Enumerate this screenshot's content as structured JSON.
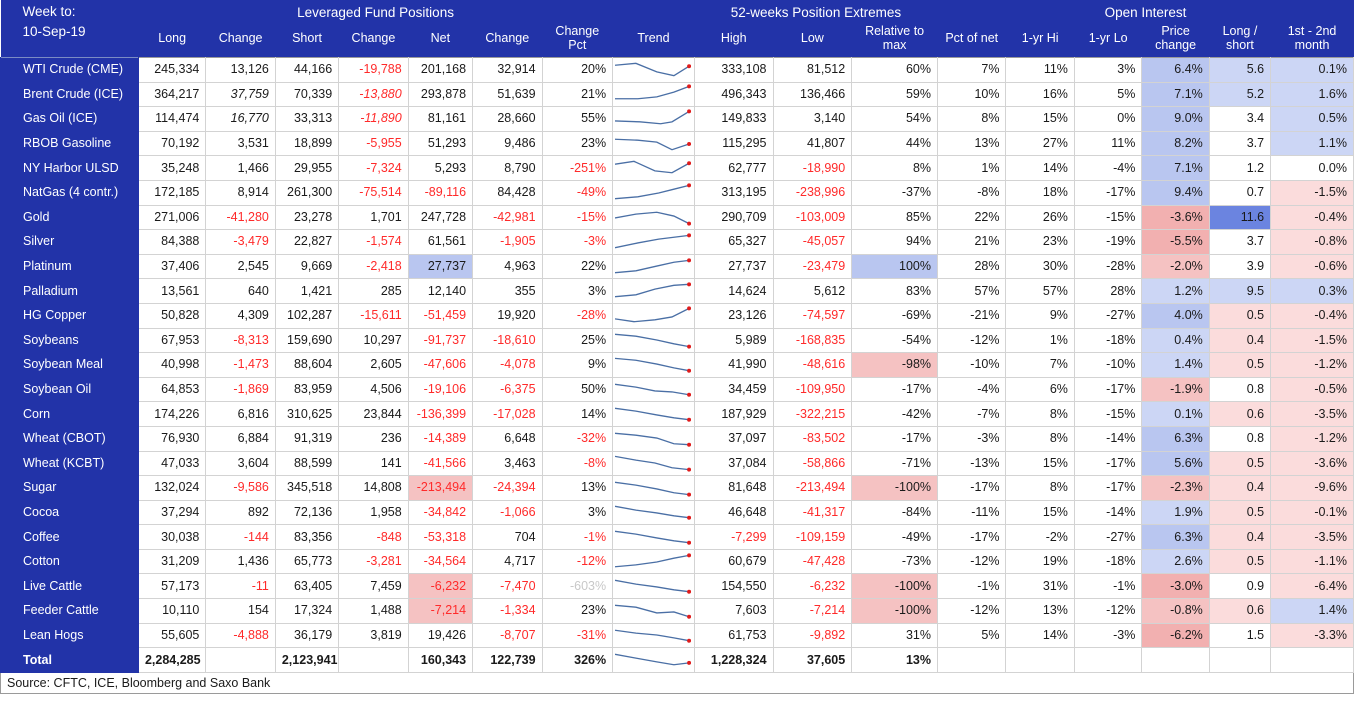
{
  "header": {
    "week_to_label": "Week to:",
    "week_to_date": "10-Sep-19",
    "groups": {
      "leveraged": "Leveraged Fund Positions",
      "trend": "Trend",
      "extremes": "52-weeks Position Extremes",
      "open_interest": "Open Interest"
    },
    "columns": {
      "long": "Long",
      "change1": "Change",
      "short": "Short",
      "change2": "Change",
      "net": "Net",
      "change3": "Change",
      "change_pct": "Change Pct",
      "trend": "Trend",
      "high": "High",
      "low": "Low",
      "rel_to_max": "Relative to max",
      "pct_of_net": "Pct of net",
      "yr_hi": "1-yr Hi",
      "yr_lo": "1-yr Lo",
      "price_change": "Price change",
      "long_short": "Long / short",
      "first_second": "1st - 2nd month"
    }
  },
  "colors": {
    "header_blue": "#2233a8",
    "negative_red": "#ff2a2a",
    "heat_blue_light": "#ccd6f5",
    "heat_blue_strong": "#6b84e0",
    "heat_red_light": "#fbdcdc",
    "heat_red_strong": "#f2b0b0"
  },
  "rows": [
    {
      "name": "WTI Crude (CME)",
      "long": "245,334",
      "change1": "13,126",
      "short": "44,166",
      "change2": "-19,788",
      "net": "201,168",
      "change3": "32,914",
      "change_pct": "20%",
      "high": "333,108",
      "low": "81,512",
      "rel": "60%",
      "pct_net": "7%",
      "yr_hi": "11%",
      "yr_lo": "3%",
      "price": "6.4%",
      "ls": "5.6",
      "m12": "0.1%"
    },
    {
      "name": "Brent Crude (ICE)",
      "long": "364,217",
      "change1": "37,759",
      "short": "70,339",
      "change2": "-13,880",
      "net": "293,878",
      "change3": "51,639",
      "change_pct": "21%",
      "high": "496,343",
      "low": "136,466",
      "rel": "59%",
      "pct_net": "10%",
      "yr_hi": "16%",
      "yr_lo": "5%",
      "price": "7.1%",
      "ls": "5.2",
      "m12": "1.6%"
    },
    {
      "name": "Gas Oil (ICE)",
      "long": "114,474",
      "change1": "16,770",
      "short": "33,313",
      "change2": "-11,890",
      "net": "81,161",
      "change3": "28,660",
      "change_pct": "55%",
      "high": "149,833",
      "low": "3,140",
      "rel": "54%",
      "pct_net": "8%",
      "yr_hi": "15%",
      "yr_lo": "0%",
      "price": "9.0%",
      "ls": "3.4",
      "m12": "0.5%"
    },
    {
      "name": "RBOB Gasoline",
      "long": "70,192",
      "change1": "3,531",
      "short": "18,899",
      "change2": "-5,955",
      "net": "51,293",
      "change3": "9,486",
      "change_pct": "23%",
      "high": "115,295",
      "low": "41,807",
      "rel": "44%",
      "pct_net": "13%",
      "yr_hi": "27%",
      "yr_lo": "11%",
      "price": "8.2%",
      "ls": "3.7",
      "m12": "1.1%"
    },
    {
      "name": "NY Harbor ULSD",
      "long": "35,248",
      "change1": "1,466",
      "short": "29,955",
      "change2": "-7,324",
      "net": "5,293",
      "change3": "8,790",
      "change_pct": "-251%",
      "high": "62,777",
      "low": "-18,990",
      "rel": "8%",
      "pct_net": "1%",
      "yr_hi": "14%",
      "yr_lo": "-4%",
      "price": "7.1%",
      "ls": "1.2",
      "m12": "0.0%"
    },
    {
      "name": "NatGas (4 contr.)",
      "long": "172,185",
      "change1": "8,914",
      "short": "261,300",
      "change2": "-75,514",
      "net": "-89,116",
      "change3": "84,428",
      "change_pct": "-49%",
      "high": "313,195",
      "low": "-238,996",
      "rel": "-37%",
      "pct_net": "-8%",
      "yr_hi": "18%",
      "yr_lo": "-17%",
      "price": "9.4%",
      "ls": "0.7",
      "m12": "-1.5%"
    },
    {
      "name": "Gold",
      "long": "271,006",
      "change1": "-41,280",
      "short": "23,278",
      "change2": "1,701",
      "net": "247,728",
      "change3": "-42,981",
      "change_pct": "-15%",
      "high": "290,709",
      "low": "-103,009",
      "rel": "85%",
      "pct_net": "22%",
      "yr_hi": "26%",
      "yr_lo": "-15%",
      "price": "-3.6%",
      "ls": "11.6",
      "m12": "-0.4%"
    },
    {
      "name": "Silver",
      "long": "84,388",
      "change1": "-3,479",
      "short": "22,827",
      "change2": "-1,574",
      "net": "61,561",
      "change3": "-1,905",
      "change_pct": "-3%",
      "high": "65,327",
      "low": "-45,057",
      "rel": "94%",
      "pct_net": "21%",
      "yr_hi": "23%",
      "yr_lo": "-19%",
      "price": "-5.5%",
      "ls": "3.7",
      "m12": "-0.8%"
    },
    {
      "name": "Platinum",
      "long": "37,406",
      "change1": "2,545",
      "short": "9,669",
      "change2": "-2,418",
      "net": "27,737",
      "change3": "4,963",
      "change_pct": "22%",
      "high": "27,737",
      "low": "-23,479",
      "rel": "100%",
      "pct_net": "28%",
      "yr_hi": "30%",
      "yr_lo": "-28%",
      "price": "-2.0%",
      "ls": "3.9",
      "m12": "-0.6%"
    },
    {
      "name": "Palladium",
      "long": "13,561",
      "change1": "640",
      "short": "1,421",
      "change2": "285",
      "net": "12,140",
      "change3": "355",
      "change_pct": "3%",
      "high": "14,624",
      "low": "5,612",
      "rel": "83%",
      "pct_net": "57%",
      "yr_hi": "57%",
      "yr_lo": "28%",
      "price": "1.2%",
      "ls": "9.5",
      "m12": "0.3%"
    },
    {
      "name": "HG Copper",
      "long": "50,828",
      "change1": "4,309",
      "short": "102,287",
      "change2": "-15,611",
      "net": "-51,459",
      "change3": "19,920",
      "change_pct": "-28%",
      "high": "23,126",
      "low": "-74,597",
      "rel": "-69%",
      "pct_net": "-21%",
      "yr_hi": "9%",
      "yr_lo": "-27%",
      "price": "4.0%",
      "ls": "0.5",
      "m12": "-0.4%"
    },
    {
      "name": "Soybeans",
      "long": "67,953",
      "change1": "-8,313",
      "short": "159,690",
      "change2": "10,297",
      "net": "-91,737",
      "change3": "-18,610",
      "change_pct": "25%",
      "high": "5,989",
      "low": "-168,835",
      "rel": "-54%",
      "pct_net": "-12%",
      "yr_hi": "1%",
      "yr_lo": "-18%",
      "price": "0.4%",
      "ls": "0.4",
      "m12": "-1.5%"
    },
    {
      "name": "Soybean Meal",
      "long": "40,998",
      "change1": "-1,473",
      "short": "88,604",
      "change2": "2,605",
      "net": "-47,606",
      "change3": "-4,078",
      "change_pct": "9%",
      "high": "41,990",
      "low": "-48,616",
      "rel": "-98%",
      "pct_net": "-10%",
      "yr_hi": "7%",
      "yr_lo": "-10%",
      "price": "1.4%",
      "ls": "0.5",
      "m12": "-1.2%"
    },
    {
      "name": "Soybean Oil",
      "long": "64,853",
      "change1": "-1,869",
      "short": "83,959",
      "change2": "4,506",
      "net": "-19,106",
      "change3": "-6,375",
      "change_pct": "50%",
      "high": "34,459",
      "low": "-109,950",
      "rel": "-17%",
      "pct_net": "-4%",
      "yr_hi": "6%",
      "yr_lo": "-17%",
      "price": "-1.9%",
      "ls": "0.8",
      "m12": "-0.5%"
    },
    {
      "name": "Corn",
      "long": "174,226",
      "change1": "6,816",
      "short": "310,625",
      "change2": "23,844",
      "net": "-136,399",
      "change3": "-17,028",
      "change_pct": "14%",
      "high": "187,929",
      "low": "-322,215",
      "rel": "-42%",
      "pct_net": "-7%",
      "yr_hi": "8%",
      "yr_lo": "-15%",
      "price": "0.1%",
      "ls": "0.6",
      "m12": "-3.5%"
    },
    {
      "name": "Wheat (CBOT)",
      "long": "76,930",
      "change1": "6,884",
      "short": "91,319",
      "change2": "236",
      "net": "-14,389",
      "change3": "6,648",
      "change_pct": "-32%",
      "high": "37,097",
      "low": "-83,502",
      "rel": "-17%",
      "pct_net": "-3%",
      "yr_hi": "8%",
      "yr_lo": "-14%",
      "price": "6.3%",
      "ls": "0.8",
      "m12": "-1.2%"
    },
    {
      "name": "Wheat (KCBT)",
      "long": "47,033",
      "change1": "3,604",
      "short": "88,599",
      "change2": "141",
      "net": "-41,566",
      "change3": "3,463",
      "change_pct": "-8%",
      "high": "37,084",
      "low": "-58,866",
      "rel": "-71%",
      "pct_net": "-13%",
      "yr_hi": "15%",
      "yr_lo": "-17%",
      "price": "5.6%",
      "ls": "0.5",
      "m12": "-3.6%"
    },
    {
      "name": "Sugar",
      "long": "132,024",
      "change1": "-9,586",
      "short": "345,518",
      "change2": "14,808",
      "net": "-213,494",
      "change3": "-24,394",
      "change_pct": "13%",
      "high": "81,648",
      "low": "-213,494",
      "rel": "-100%",
      "pct_net": "-17%",
      "yr_hi": "8%",
      "yr_lo": "-17%",
      "price": "-2.3%",
      "ls": "0.4",
      "m12": "-9.6%"
    },
    {
      "name": "Cocoa",
      "long": "37,294",
      "change1": "892",
      "short": "72,136",
      "change2": "1,958",
      "net": "-34,842",
      "change3": "-1,066",
      "change_pct": "3%",
      "high": "46,648",
      "low": "-41,317",
      "rel": "-84%",
      "pct_net": "-11%",
      "yr_hi": "15%",
      "yr_lo": "-14%",
      "price": "1.9%",
      "ls": "0.5",
      "m12": "-0.1%"
    },
    {
      "name": "Coffee",
      "long": "30,038",
      "change1": "-144",
      "short": "83,356",
      "change2": "-848",
      "net": "-53,318",
      "change3": "704",
      "change_pct": "-1%",
      "high": "-7,299",
      "low": "-109,159",
      "rel": "-49%",
      "pct_net": "-17%",
      "yr_hi": "-2%",
      "yr_lo": "-27%",
      "price": "6.3%",
      "ls": "0.4",
      "m12": "-3.5%"
    },
    {
      "name": "Cotton",
      "long": "31,209",
      "change1": "1,436",
      "short": "65,773",
      "change2": "-3,281",
      "net": "-34,564",
      "change3": "4,717",
      "change_pct": "-12%",
      "high": "60,679",
      "low": "-47,428",
      "rel": "-73%",
      "pct_net": "-12%",
      "yr_hi": "19%",
      "yr_lo": "-18%",
      "price": "2.6%",
      "ls": "0.5",
      "m12": "-1.1%"
    },
    {
      "name": "Live Cattle",
      "long": "57,173",
      "change1": "-11",
      "short": "63,405",
      "change2": "7,459",
      "net": "-6,232",
      "change3": "-7,470",
      "change_pct": "-603%",
      "high": "154,550",
      "low": "-6,232",
      "rel": "-100%",
      "pct_net": "-1%",
      "yr_hi": "31%",
      "yr_lo": "-1%",
      "price": "-3.0%",
      "ls": "0.9",
      "m12": "-6.4%"
    },
    {
      "name": "Feeder Cattle",
      "long": "10,110",
      "change1": "154",
      "short": "17,324",
      "change2": "1,488",
      "net": "-7,214",
      "change3": "-1,334",
      "change_pct": "23%",
      "high": "7,603",
      "low": "-7,214",
      "rel": "-100%",
      "pct_net": "-12%",
      "yr_hi": "13%",
      "yr_lo": "-12%",
      "price": "-0.8%",
      "ls": "0.6",
      "m12": "1.4%"
    },
    {
      "name": "Lean Hogs",
      "long": "55,605",
      "change1": "-4,888",
      "short": "36,179",
      "change2": "3,819",
      "net": "19,426",
      "change3": "-8,707",
      "change_pct": "-31%",
      "high": "61,753",
      "low": "-9,892",
      "rel": "31%",
      "pct_net": "5%",
      "yr_hi": "14%",
      "yr_lo": "-3%",
      "price": "-6.2%",
      "ls": "1.5",
      "m12": "-3.3%"
    }
  ],
  "total": {
    "name": "Total",
    "long": "2,284,285",
    "change1": "",
    "short": "2,123,941",
    "change2": "",
    "net": "160,343",
    "change3": "122,739",
    "change_pct": "326%",
    "high": "1,228,324",
    "low": "37,605",
    "rel": "13%",
    "pct_net": "",
    "yr_hi": "",
    "yr_lo": "",
    "price": "",
    "ls": "",
    "m12": ""
  },
  "footer": {
    "source": "Source: CFTC, ICE, Bloomberg and Saxo Bank"
  },
  "trend_icon": "sparkline-icon",
  "sparklines": [
    [
      0,
      6,
      22,
      4,
      44,
      13,
      62,
      17,
      78,
      7
    ],
    [
      0,
      16,
      24,
      16,
      44,
      14,
      62,
      9,
      78,
      3
    ],
    [
      0,
      13,
      26,
      14,
      48,
      16,
      60,
      14,
      78,
      3
    ],
    [
      0,
      6,
      24,
      7,
      44,
      9,
      60,
      17,
      78,
      11
    ],
    [
      0,
      7,
      20,
      4,
      42,
      14,
      60,
      16,
      78,
      6
    ],
    [
      0,
      17,
      24,
      15,
      46,
      11,
      62,
      7,
      78,
      3
    ],
    [
      0,
      12,
      22,
      8,
      44,
      6,
      62,
      10,
      78,
      18
    ],
    [
      0,
      17,
      24,
      12,
      46,
      8,
      62,
      6,
      78,
      4
    ],
    [
      0,
      17,
      22,
      15,
      44,
      10,
      62,
      6,
      78,
      4
    ],
    [
      0,
      17,
      22,
      15,
      42,
      9,
      62,
      5,
      78,
      4
    ],
    [
      0,
      14,
      20,
      17,
      42,
      15,
      60,
      12,
      78,
      3
    ],
    [
      0,
      5,
      22,
      7,
      44,
      11,
      62,
      15,
      78,
      18
    ],
    [
      0,
      4,
      22,
      6,
      44,
      10,
      62,
      14,
      78,
      17
    ],
    [
      0,
      5,
      22,
      8,
      42,
      12,
      60,
      13,
      78,
      16
    ],
    [
      0,
      5,
      22,
      8,
      44,
      12,
      62,
      15,
      78,
      17
    ],
    [
      0,
      5,
      22,
      7,
      44,
      10,
      62,
      16,
      78,
      17
    ],
    [
      0,
      4,
      22,
      8,
      42,
      11,
      60,
      16,
      78,
      18
    ],
    [
      0,
      5,
      22,
      8,
      44,
      12,
      62,
      16,
      78,
      18
    ],
    [
      0,
      5,
      22,
      9,
      44,
      12,
      62,
      15,
      78,
      17
    ],
    [
      0,
      5,
      22,
      8,
      44,
      12,
      62,
      15,
      78,
      17
    ],
    [
      0,
      16,
      22,
      14,
      44,
      11,
      62,
      7,
      78,
      4
    ],
    [
      0,
      5,
      22,
      9,
      44,
      12,
      62,
      15,
      78,
      17
    ],
    [
      0,
      5,
      22,
      7,
      44,
      13,
      62,
      12,
      78,
      17
    ],
    [
      0,
      6,
      22,
      9,
      44,
      11,
      62,
      14,
      78,
      17
    ],
    [
      0,
      5,
      22,
      9,
      44,
      13,
      62,
      16,
      78,
      14
    ]
  ]
}
